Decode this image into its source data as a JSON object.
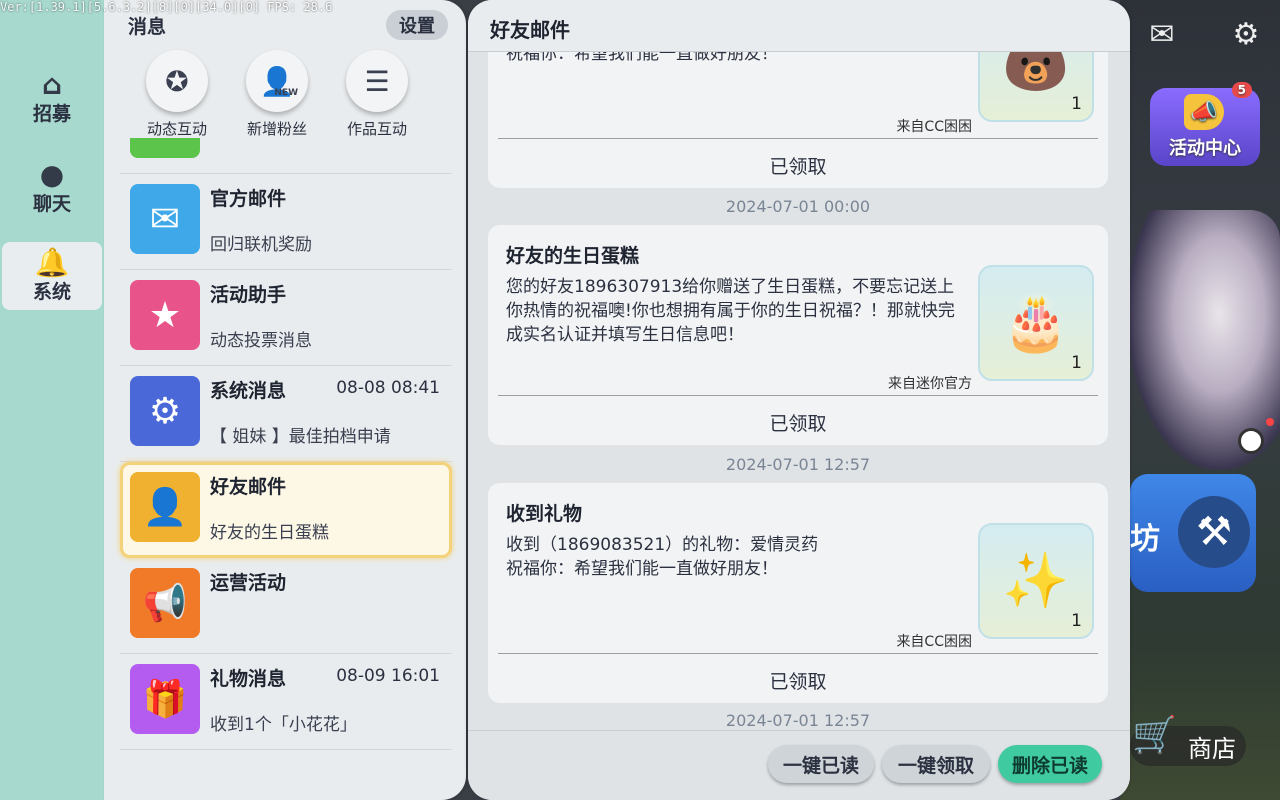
{
  "version_text": "Ver:[1.39.1][5.6.3.2][8][0][34.0][0] FPS: 28.6",
  "rail": {
    "items": [
      {
        "label": "招募",
        "icon": "home-icon"
      },
      {
        "label": "聊天",
        "icon": "chat-bubble-icon"
      },
      {
        "label": "系统",
        "icon": "bell-icon",
        "active": true
      }
    ]
  },
  "list_panel": {
    "title": "消息",
    "settings_label": "设置",
    "quick": [
      {
        "label": "动态互动",
        "icon": "star-bubble-icon"
      },
      {
        "label": "新增粉丝",
        "icon": "person-new-icon",
        "tag": "NEW"
      },
      {
        "label": "作品互动",
        "icon": "list-doc-icon"
      }
    ],
    "messages": [
      {
        "title": "官方邮件",
        "sub": "回归联机奖励",
        "time": "",
        "icon": "envelope-icon",
        "color": "#3ea8e8"
      },
      {
        "title": "活动助手",
        "sub": "动态投票消息",
        "time": "",
        "icon": "bookmark-star-icon",
        "color": "#e8548a"
      },
      {
        "title": "系统消息",
        "sub": "【 姐妹 】最佳拍档申请",
        "time": "08-08 08:41",
        "icon": "gear-icon",
        "color": "#4a68d8"
      },
      {
        "title": "好友邮件",
        "sub": "好友的生日蛋糕",
        "time": "",
        "icon": "friend-mail-icon",
        "color": "#f0b030",
        "selected": true
      },
      {
        "title": "运营活动",
        "sub": "",
        "time": "",
        "icon": "megaphone-icon",
        "color": "#f07a28"
      },
      {
        "title": "礼物消息",
        "sub": "收到1个「小花花」",
        "time": "08-09 16:01",
        "icon": "gift-icon",
        "color": "#b45cf0"
      }
    ]
  },
  "detail": {
    "title": "好友邮件",
    "cards": [
      {
        "title": "",
        "text": "祝福你：希望我们能一直做好朋友！",
        "from": "来自CC困困",
        "qty": "1",
        "claimed": "已领取",
        "thumb_icon": "bear-icon"
      },
      {
        "date": "2024-07-01 00:00",
        "title": "好友的生日蛋糕",
        "text": "您的好友1896307913给你赠送了生日蛋糕，不要忘记送上你热情的祝福噢!你也想拥有属于你的生日祝福？！那就快完成实名认证并填写生日信息吧！",
        "from": "来自迷你官方",
        "qty": "1",
        "claimed": "已领取",
        "thumb_icon": "cake-icon"
      },
      {
        "date": "2024-07-01 12:57",
        "title": "收到礼物",
        "text": "收到（1869083521）的礼物：爱情灵药\n祝福你：希望我们能一直做好朋友！",
        "from": "来自CC困困",
        "qty": "1",
        "claimed": "已领取",
        "thumb_icon": "potion-icon"
      }
    ],
    "trailing_date": "2024-07-01 12:57",
    "footer": {
      "mark_read": "一键已读",
      "claim_all": "一键领取",
      "delete_read": "删除已读"
    }
  },
  "game": {
    "activity_label": "活动中心",
    "activity_badge": "5",
    "shop_label": "商店",
    "build_partial": "坊"
  }
}
